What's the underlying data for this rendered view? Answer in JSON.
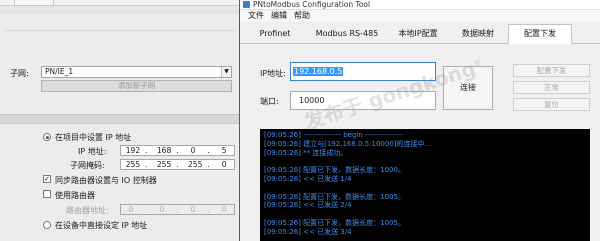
{
  "background_panel": {
    "subnet_label": "子网:",
    "subnet_value": "PN/IE_1",
    "add_subnet_button": "添加新子网",
    "options": {
      "set_ip_in_project": "在项目中设置 IP 地址",
      "ip_address_label": "IP 地址:",
      "ip_address": [
        "192",
        "168",
        "0",
        "5"
      ],
      "subnet_mask_label": "子网掩码:",
      "subnet_mask": [
        "255",
        "255",
        "255",
        "0"
      ],
      "sync_router": "同步路由器设置与 IO 控制器",
      "use_router": "使用路由器",
      "router_address_label": "路由器地址:",
      "router_address": [
        "0",
        "0",
        "0",
        "0"
      ],
      "set_ip_directly": "在设备中直接设定 IP 地址"
    }
  },
  "dialog": {
    "title": "PNtoModbus Configuration Tool",
    "menu": [
      "文件",
      "编辑",
      "帮助"
    ],
    "tabs": [
      "Profinet",
      "Modbus RS-485",
      "本地IP配置",
      "数据映射",
      "配置下发"
    ],
    "active_tab": "配置下发",
    "ip_label": "IP地址:",
    "ip_value": "192.168.0.5",
    "port_label": "端口:",
    "port_value": "10000",
    "connect_button": "连接",
    "side_buttons": [
      "配置下发",
      "正常",
      "复位"
    ],
    "log_lines": [
      "[09:05:26] --------------- begin ---------------",
      "[09:05:26] 建立与[192.168.0.5:10000]的连接中...",
      "[09:05:26] ** 连接成功。",
      "",
      "[09:05:26] 配置已下发，数据长度：1000。",
      "[09:05:26] << 已发送 1/4",
      "",
      "[09:05:26] 配置已下发，数据长度：1005。",
      "[09:05:26] << 已发送 2/4",
      "",
      "[09:05:26] 配置已下发，数据长度：1005。",
      "[09:05:26] << 已发送 3/4"
    ],
    "log_color": "#3e8ef0"
  },
  "watermark": {
    "text": "发布于 gongkong",
    "mark": "®"
  }
}
